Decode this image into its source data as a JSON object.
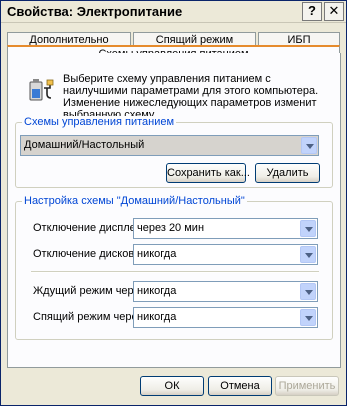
{
  "window": {
    "title": "Свойства: Электропитание",
    "help_button": "?",
    "close_button": "✕"
  },
  "tabs": [
    {
      "label": "Дополнительно",
      "active": false
    },
    {
      "label": "Спящий режим",
      "active": false
    },
    {
      "label": "ИБП",
      "active": false
    },
    {
      "label": "Схемы управления питанием",
      "active": true
    }
  ],
  "intro_text": "Выберите схему управления питанием с наилучшими параметрами для этого компьютера. Изменение нижеследующих параметров изменит выбранную схему.",
  "scheme_group": {
    "legend": "Схемы управления питанием",
    "selected_scheme": "Домашний/Настольный",
    "save_as_label": "Сохранить как...",
    "delete_label": "Удалить"
  },
  "settings_group": {
    "legend": "Настройка схемы \"Домашний/Настольный\"",
    "display_off_label": "Отключение дисплея:",
    "display_off_value": "через 20 мин",
    "disks_off_label": "Отключение дисков:",
    "disks_off_value": "никогда",
    "standby_label": "Ждущий режим через:",
    "standby_value": "никогда",
    "hibernate_label": "Спящий режим через:",
    "hibernate_value": "никогда"
  },
  "footer": {
    "ok_label": "ОК",
    "cancel_label": "Отмена",
    "apply_label": "Применить",
    "apply_enabled": false
  },
  "icons": {
    "power_scheme_icon": "power-plug-battery-icon"
  }
}
